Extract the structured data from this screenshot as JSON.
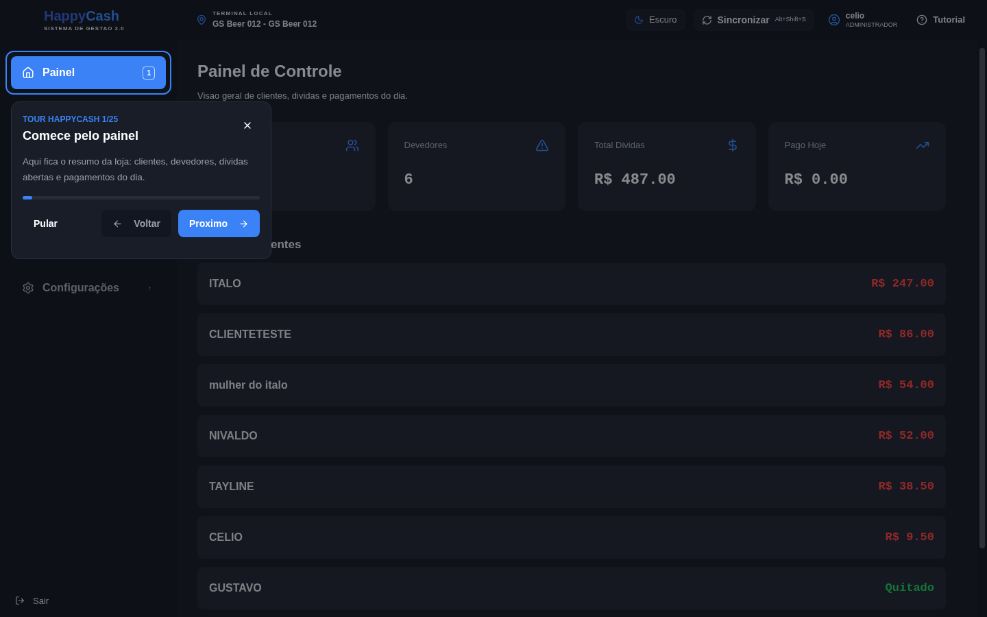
{
  "header": {
    "logo": {
      "part_1": "Happy",
      "part_2": "Cash",
      "subtitle": "SISTEMA DE GESTAO 2.0"
    },
    "terminal": {
      "label": "TERMINAL LOCAL",
      "value": "GS Beer 012 - GS Beer 012"
    },
    "theme_button": "Escuro",
    "sync_button": {
      "label": "Sincronizar",
      "shortcut": "Alt+Shift+S"
    },
    "user": {
      "name": "celio",
      "role": "ADMINISTRADOR"
    },
    "tutorial_button": "Tutorial"
  },
  "sidebar": {
    "items": [
      {
        "kind": "home",
        "label": "Painel",
        "badge": "1",
        "selected": true
      },
      {
        "kind": "settings",
        "label": "Configurações",
        "badge": "↑",
        "selected": false
      }
    ],
    "logout": "Sair"
  },
  "page": {
    "title": "Painel de Controle",
    "subtitle": "Visao geral de clientes, dividas e pagamentos do dia."
  },
  "stats": [
    {
      "kind": "users"
    },
    {
      "kind": "alert",
      "title": "Devedores",
      "value": "6"
    },
    {
      "kind": "dollar",
      "title": "Total Dividas",
      "value": "R$ 487.00"
    },
    {
      "kind": "trend",
      "title": "Pago Hoje",
      "value": "R$ 0.00"
    }
  ],
  "section_title": "entes",
  "clients": [
    {
      "name": "ITALO",
      "amount": "R$ 247.00",
      "paid": false
    },
    {
      "name": "CLIENTETESTE",
      "amount": "R$ 86.00",
      "paid": false
    },
    {
      "name": "mulher do italo",
      "amount": "R$ 54.00",
      "paid": false
    },
    {
      "name": "NIVALDO",
      "amount": "R$ 52.00",
      "paid": false
    },
    {
      "name": "TAYLINE",
      "amount": "R$ 38.50",
      "paid": false
    },
    {
      "name": "CELIO",
      "amount": "R$ 9.50",
      "paid": false
    },
    {
      "name": "GUSTAVO",
      "amount": "Quitado",
      "paid": true
    }
  ],
  "tour": {
    "step": "TOUR HAPPYCASH 1/25",
    "title": "Comece pelo painel",
    "text": "Aqui fica o resumo da loja: clientes, devedores, dividas abertas e pagamentos do dia.",
    "level": 0.04,
    "skip": "Pular",
    "back": "Voltar",
    "next": "Proximo"
  }
}
